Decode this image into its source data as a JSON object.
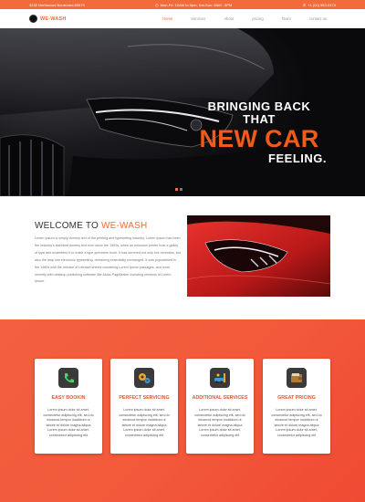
{
  "topbar": {
    "address": "3232 Northwood Boulevard,60679",
    "hours": "Mon-Fri: 10AM to 5pm, Sat-Sun: 8AM - 5PM",
    "phone": "+1 (00) 553-0174"
  },
  "nav": {
    "brand": "WE-WASH",
    "items": [
      "Home",
      "Services",
      "About",
      "pricing",
      "Team",
      "contact us"
    ],
    "active_index": 0
  },
  "hero": {
    "line1": "BRINGING BACK",
    "line2": "THAT",
    "line3": "NEW CAR",
    "line4": "FEELING.",
    "slides": 2,
    "current_slide": 1
  },
  "welcome": {
    "title_prefix": "WELCOME TO ",
    "title_accent": "WE-WASH",
    "body": "Lorem Ipsum is simply dummy text of the printing and typesetting industry. Lorem Ipsum has been the industry's standard dummy text ever since the 1500s, when an unknown printer took a galley of type and scrambled it to make a type specimen book. It has survived not only five centuries, but also the leap into electronic typesetting, remaining essentially unchanged. It was popularised in the 1960s with the release of Letraset sheets containing Lorem Ipsum passages, and more recently with desktop publishing software like Aldus PageMaker including versions of Lorem Ipsum."
  },
  "services": [
    {
      "title": "EASY BOOKIN",
      "icon": "phone-icon",
      "body": "Lorem ipsum dolor sit amet, consectetur adipiscing elit, sed do eiusmod tempor incididunt ut labore et dolore magna aliqua Lorem ipsum dolor sit amet, consectetur adipiscing elit"
    },
    {
      "title": "PERFECT SERVICING",
      "icon": "gears-icon",
      "body": "Lorem ipsum dolor sit amet, consectetur adipiscing elit, sed do eiusmod tempor incididunt ut labore et dolore magna aliqua Lorem ipsum dolor sit amet, consectetur adipiscing elit"
    },
    {
      "title": "ADDITIONAL SERVICES",
      "icon": "car-wash-icon",
      "body": "Lorem ipsum dolor sit amet, consectetur adipiscing elit, sed do eiusmod tempor incididunt ut labore et dolore magna aliqua Lorem ipsum dolor sit amet, consectetur adipiscing elit"
    },
    {
      "title": "GREAT PRICING",
      "icon": "wallet-icon",
      "body": "Lorem ipsum dolor sit amet, consectetur adipiscing elit, sed do eiusmod tempor incididunt ut labore et dolore magna aliqua Lorem ipsum dolor sit amet, consectetur adipiscing elit"
    }
  ],
  "colors": {
    "accent": "#f26b3a",
    "hero_accent": "#f25a1b"
  }
}
